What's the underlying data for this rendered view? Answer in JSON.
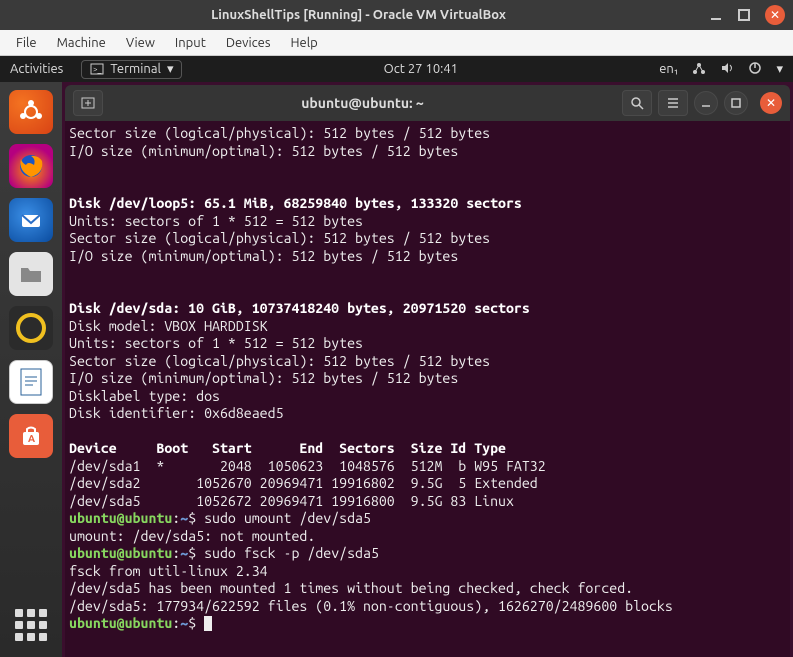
{
  "virtualbox": {
    "title": "LinuxShellTips [Running] - Oracle VM VirtualBox",
    "menu": [
      "File",
      "Machine",
      "View",
      "Input",
      "Devices",
      "Help"
    ]
  },
  "panel": {
    "activities": "Activities",
    "app_name": "Terminal",
    "clock": "Oct 27  10:41",
    "lang": "en₁"
  },
  "dock": {
    "items": [
      {
        "name": "ubuntu-launcher-icon"
      },
      {
        "name": "firefox-icon"
      },
      {
        "name": "thunderbird-icon"
      },
      {
        "name": "files-icon"
      },
      {
        "name": "rhythmbox-icon"
      },
      {
        "name": "libreoffice-writer-icon"
      },
      {
        "name": "ubuntu-software-icon"
      }
    ]
  },
  "terminal": {
    "title": "ubuntu@ubuntu: ~",
    "prompt_user": "ubuntu@ubuntu",
    "prompt_sep": ":",
    "prompt_path": "~",
    "prompt_end": "$ ",
    "lines": {
      "l01": "Sector size (logical/physical): 512 bytes / 512 bytes",
      "l02": "I/O size (minimum/optimal): 512 bytes / 512 bytes",
      "l03": "",
      "l04": "",
      "l05": "Disk /dev/loop5: 65.1 MiB, 68259840 bytes, 133320 sectors",
      "l06": "Units: sectors of 1 * 512 = 512 bytes",
      "l07": "Sector size (logical/physical): 512 bytes / 512 bytes",
      "l08": "I/O size (minimum/optimal): 512 bytes / 512 bytes",
      "l09": "",
      "l10": "",
      "l11": "Disk /dev/sda: 10 GiB, 10737418240 bytes, 20971520 sectors",
      "l12": "Disk model: VBOX HARDDISK   ",
      "l13": "Units: sectors of 1 * 512 = 512 bytes",
      "l14": "Sector size (logical/physical): 512 bytes / 512 bytes",
      "l15": "I/O size (minimum/optimal): 512 bytes / 512 bytes",
      "l16": "Disklabel type: dos",
      "l17": "Disk identifier: 0x6d8eaed5",
      "l18": "",
      "l19": "Device     Boot   Start      End  Sectors  Size Id Type",
      "l20": "/dev/sda1  *       2048  1050623  1048576  512M  b W95 FAT32",
      "l21": "/dev/sda2       1052670 20969471 19916802  9.5G  5 Extended",
      "l22": "/dev/sda5       1052672 20969471 19916800  9.5G 83 Linux",
      "cmd1": "sudo umount /dev/sda5",
      "l24": "umount: /dev/sda5: not mounted.",
      "cmd2": "sudo fsck -p /dev/sda5",
      "l26": "fsck from util-linux 2.34",
      "l27": "/dev/sda5 has been mounted 1 times without being checked, check forced.",
      "l28": "/dev/sda5: 177934/622592 files (0.1% non-contiguous), 1626270/2489600 blocks"
    }
  }
}
